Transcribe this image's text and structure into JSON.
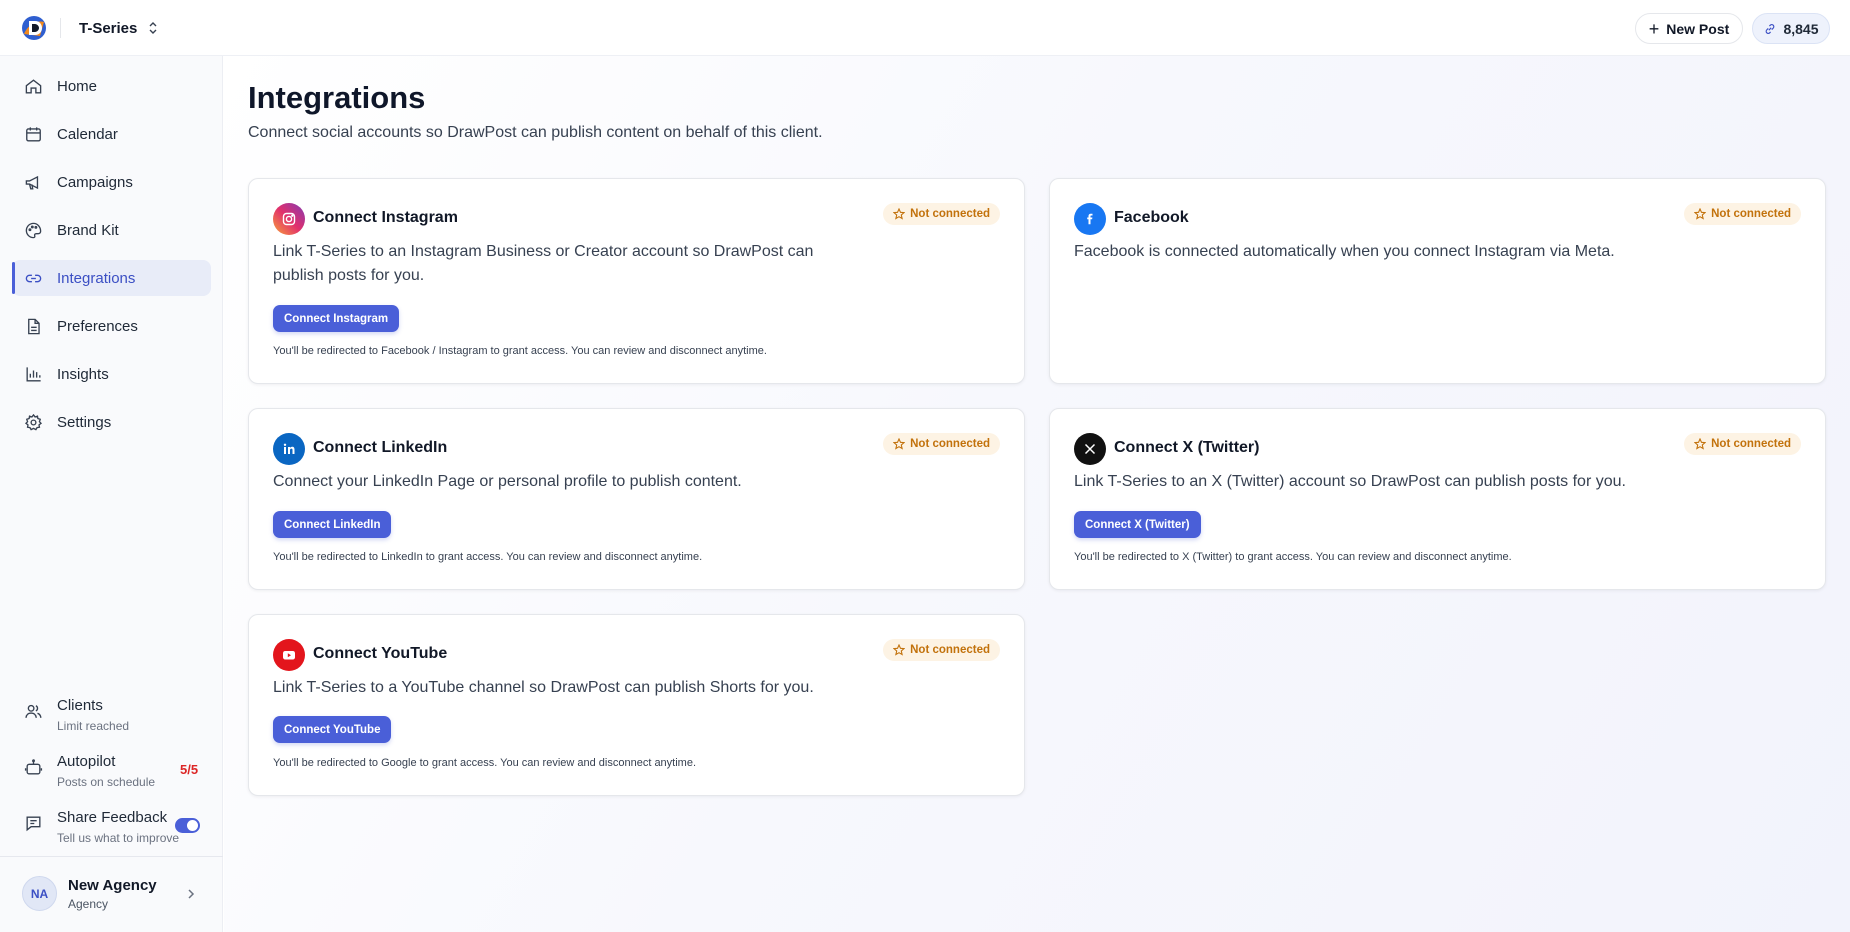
{
  "topbar": {
    "client_name": "T-Series",
    "new_post_label": "New Post",
    "credits": "8,845"
  },
  "sidebar": {
    "items": [
      {
        "label": "Home",
        "icon": "home-icon"
      },
      {
        "label": "Calendar",
        "icon": "calendar-icon"
      },
      {
        "label": "Campaigns",
        "icon": "megaphone-icon"
      },
      {
        "label": "Brand Kit",
        "icon": "palette-icon"
      },
      {
        "label": "Integrations",
        "icon": "link-icon",
        "active": true
      },
      {
        "label": "Preferences",
        "icon": "document-icon"
      },
      {
        "label": "Insights",
        "icon": "bar-chart-icon"
      },
      {
        "label": "Settings",
        "icon": "gear-icon"
      }
    ],
    "clients": {
      "label": "Clients",
      "sub": "Limit reached",
      "count": "5/5"
    },
    "autopilot": {
      "label": "Autopilot",
      "sub": "Posts on schedule",
      "enabled": true
    },
    "feedback": {
      "label": "Share Feedback",
      "sub": "Tell us what to improve"
    },
    "account": {
      "initials": "NA",
      "name": "New Agency",
      "role": "Agency"
    }
  },
  "page": {
    "title": "Integrations",
    "subtitle": "Connect social accounts so DrawPost can publish content on behalf of this client."
  },
  "cards": {
    "instagram": {
      "title": "Connect Instagram",
      "status": "Not connected",
      "description": "Link T-Series to an Instagram Business or Creator account so DrawPost can publish posts for you.",
      "button": "Connect Instagram",
      "note": "You'll be redirected to Facebook / Instagram to grant access. You can review and disconnect anytime."
    },
    "facebook": {
      "title": "Facebook",
      "status": "Not connected",
      "description": "Facebook is connected automatically when you connect Instagram via Meta."
    },
    "linkedin": {
      "title": "Connect LinkedIn",
      "status": "Not connected",
      "description": "Connect your LinkedIn Page or personal profile to publish content.",
      "button": "Connect LinkedIn",
      "note": "You'll be redirected to LinkedIn to grant access. You can review and disconnect anytime."
    },
    "twitter": {
      "title": "Connect X (Twitter)",
      "status": "Not connected",
      "description": "Link T-Series to an X (Twitter) account so DrawPost can publish posts for you.",
      "button": "Connect X (Twitter)",
      "note": "You'll be redirected to X (Twitter) to grant access. You can review and disconnect anytime."
    },
    "youtube": {
      "title": "Connect YouTube",
      "status": "Not connected",
      "description": "Link T-Series to a YouTube channel so DrawPost can publish Shorts for you.",
      "button": "Connect YouTube",
      "note": "You'll be redirected to Google to grant access. You can review and disconnect anytime."
    }
  },
  "colors": {
    "accent": "#4a5fd8",
    "badge_bg": "#fdf3e4",
    "badge_text": "#c2720c",
    "limit_red": "#dc2626"
  }
}
